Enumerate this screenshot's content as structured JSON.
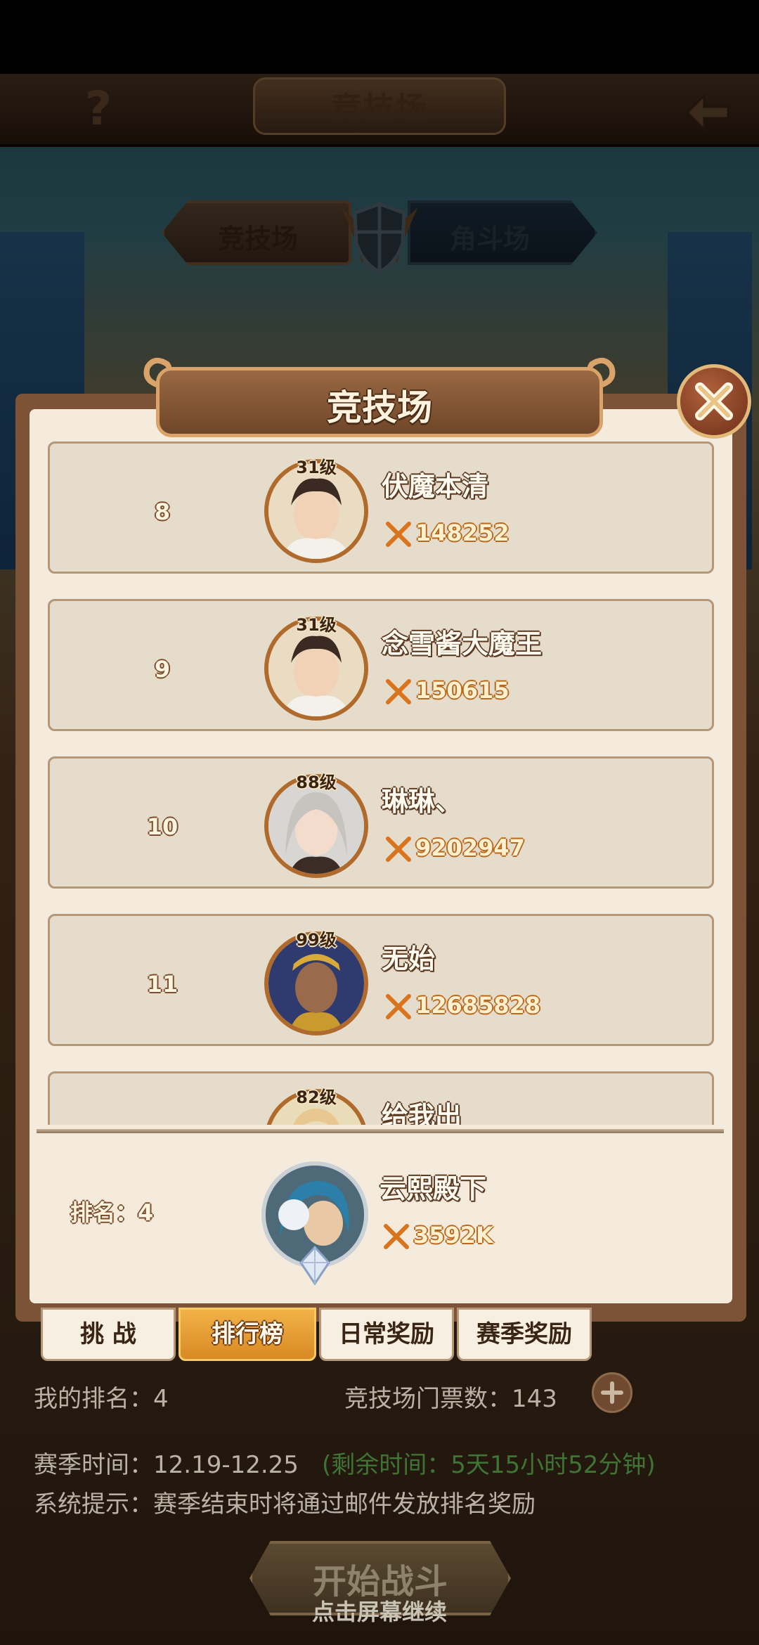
{
  "header": {
    "title": "竞技场"
  },
  "mode_tabs": {
    "arena": "竞技场",
    "duel": "角斗场"
  },
  "dialog": {
    "title": "竞技场",
    "rows": [
      {
        "rank": "8",
        "level": "31级",
        "name": "伏魔本清",
        "power": "148252"
      },
      {
        "rank": "9",
        "level": "31级",
        "name": "念雪酱大魔王",
        "power": "150615"
      },
      {
        "rank": "10",
        "level": "88级",
        "name": "琳琳、",
        "power": "9202947"
      },
      {
        "rank": "11",
        "level": "99级",
        "name": "无始",
        "power": "12685828"
      },
      {
        "rank": "",
        "level": "82级",
        "name": "给我出",
        "power": ""
      }
    ],
    "my_entry": {
      "rank_label": "排名：4",
      "name": "云熙殿下",
      "power": "3592K"
    }
  },
  "bottom_tabs": {
    "challenge": "挑 战",
    "ranking": "排行榜",
    "daily": "日常奖励",
    "season": "赛季奖励"
  },
  "info": {
    "my_rank": "我的排名：4",
    "tickets": "竞技场门票数：143",
    "season_time": "赛季时间：12.19-12.25",
    "remaining_time": "(剩余时间：5天15小时52分钟)",
    "system_tip": "系统提示：赛季结束时将通过邮件发放排名奖励"
  },
  "footer": {
    "start_battle": "开始战斗",
    "continue_hint": "点击屏幕继续"
  },
  "colors": {
    "accent_orange": "#d98923",
    "frame_brown": "#7d5337",
    "panel_cream": "#f4ebdd",
    "remaining_green": "#3f7434"
  }
}
